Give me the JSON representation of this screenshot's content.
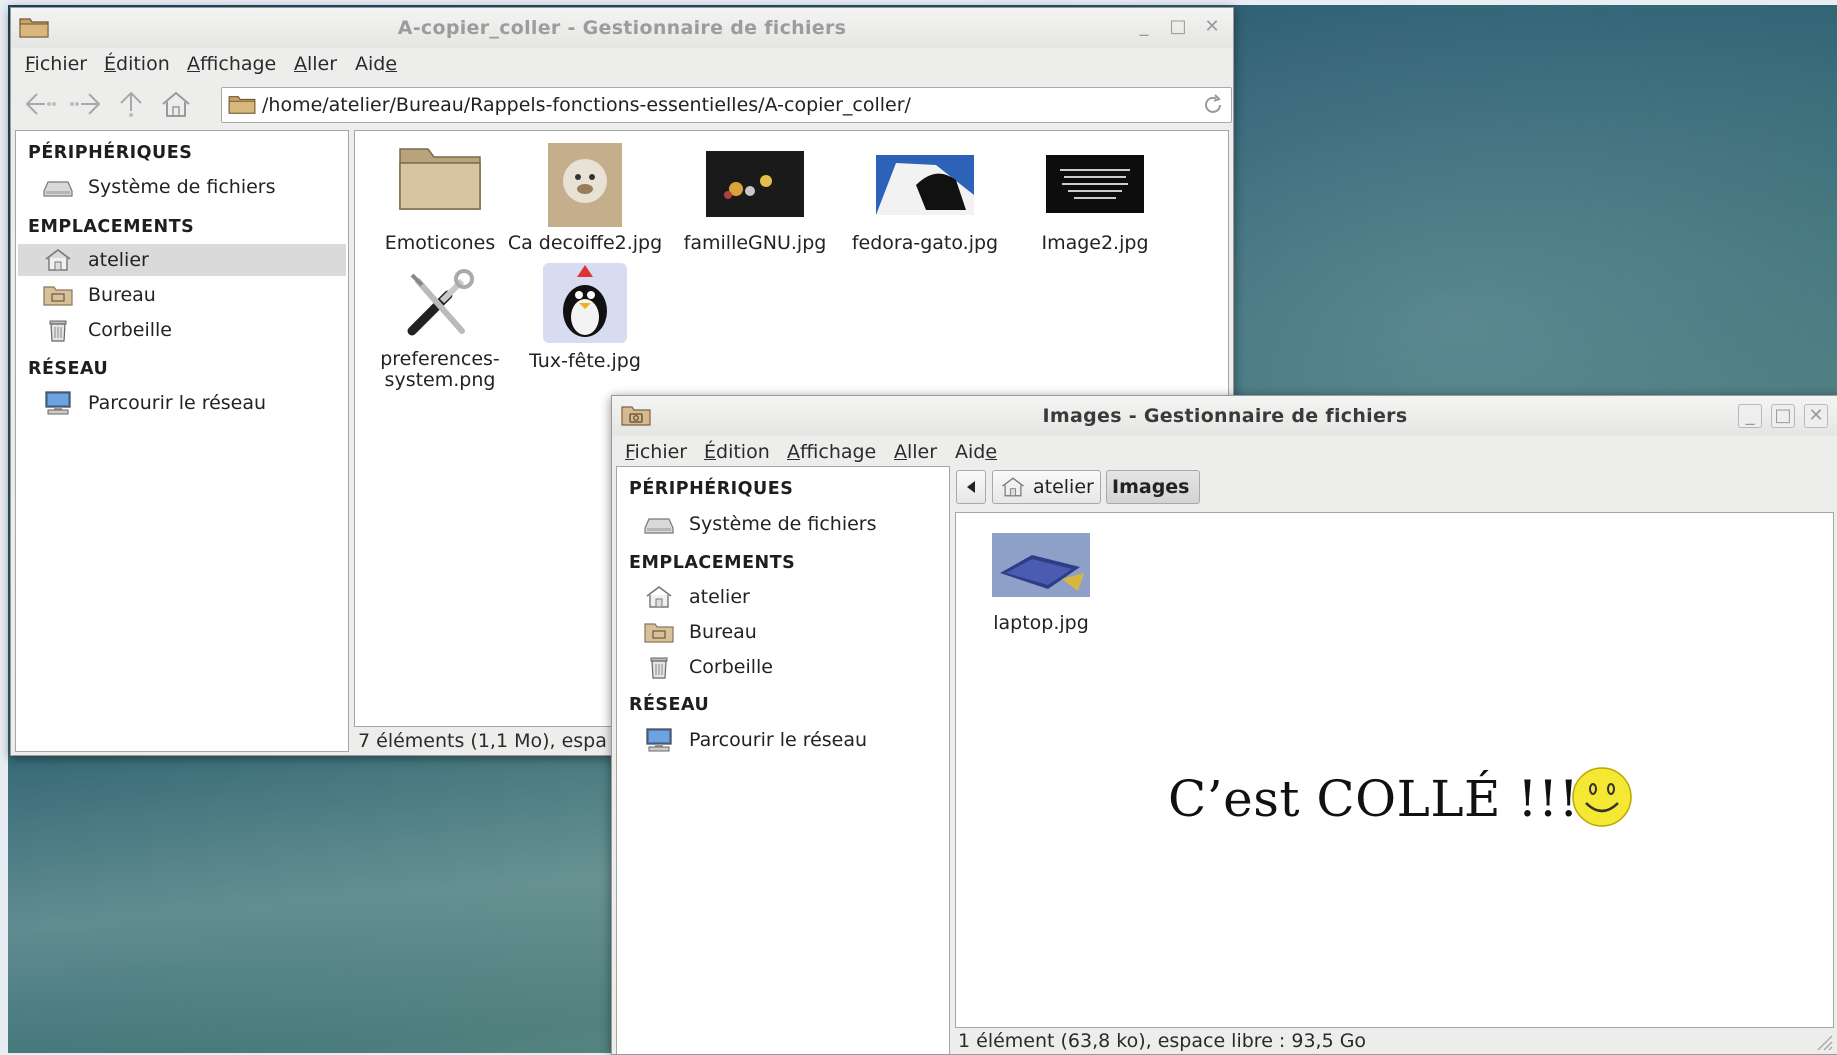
{
  "window1": {
    "title": "A-copier_coller - Gestionnaire de fichiers",
    "menu": [
      {
        "pre": "",
        "acc": "F",
        "post": "ichier"
      },
      {
        "pre": "",
        "acc": "É",
        "post": "dition"
      },
      {
        "pre": "",
        "acc": "A",
        "post": "ffichage"
      },
      {
        "pre": "",
        "acc": "A",
        "post": "ller"
      },
      {
        "pre": "Aid",
        "acc": "e",
        "post": ""
      }
    ],
    "path": "/home/atelier/Bureau/Rappels-fonctions-essentielles/A-copier_coller/",
    "sidebar": {
      "sections": [
        "PÉRIPHÉRIQUES",
        "EMPLACEMENTS",
        "RÉSEAU"
      ],
      "items": [
        {
          "label": "Système de fichiers",
          "icon": "drive-icon"
        },
        {
          "label": "atelier",
          "icon": "home-folder-icon",
          "selected": true
        },
        {
          "label": "Bureau",
          "icon": "desktop-folder-icon"
        },
        {
          "label": "Corbeille",
          "icon": "trash-icon"
        },
        {
          "label": "Parcourir le réseau",
          "icon": "network-icon"
        }
      ]
    },
    "files": [
      {
        "name": "Emoticones",
        "icon": "folder-icon"
      },
      {
        "name": "Ca decoiffe2.jpg",
        "icon": "image-thumbnail"
      },
      {
        "name": "familleGNU.jpg",
        "icon": "image-thumbnail"
      },
      {
        "name": "fedora-gato.jpg",
        "icon": "image-thumbnail"
      },
      {
        "name": "Image2.jpg",
        "icon": "image-thumbnail"
      },
      {
        "name_line1": "preferences-",
        "name_line2": "system.png",
        "icon": "tools-icon"
      },
      {
        "name": "Tux-fête.jpg",
        "icon": "image-thumbnail"
      }
    ],
    "status": "7 éléments (1,1 Mo), espa"
  },
  "window2": {
    "title": "Images - Gestionnaire de fichiers",
    "menu": [
      {
        "pre": "",
        "acc": "F",
        "post": "ichier"
      },
      {
        "pre": "",
        "acc": "É",
        "post": "dition"
      },
      {
        "pre": "",
        "acc": "A",
        "post": "ffichage"
      },
      {
        "pre": "",
        "acc": "A",
        "post": "ller"
      },
      {
        "pre": "Aid",
        "acc": "e",
        "post": ""
      }
    ],
    "breadcrumbs": [
      "atelier",
      "Images"
    ],
    "sidebar": {
      "sections": [
        "PÉRIPHÉRIQUES",
        "EMPLACEMENTS",
        "RÉSEAU"
      ],
      "items": [
        {
          "label": "Système de fichiers",
          "icon": "drive-icon"
        },
        {
          "label": "atelier",
          "icon": "home-folder-icon"
        },
        {
          "label": "Bureau",
          "icon": "desktop-folder-icon"
        },
        {
          "label": "Corbeille",
          "icon": "trash-icon"
        },
        {
          "label": "Parcourir le réseau",
          "icon": "network-icon"
        }
      ]
    },
    "files": [
      {
        "name": "laptop.jpg",
        "icon": "image-thumbnail"
      }
    ],
    "status": "1 élément (63,8 ko), espace libre : 93,5 Go"
  },
  "annotation": "C’est COLLÉ !!!",
  "colors": {
    "window_bg": "#ededec",
    "selection": "#dadada",
    "desktop": "#2c5f73",
    "folder": "#c9b48e",
    "smiley": "#f5e832"
  }
}
